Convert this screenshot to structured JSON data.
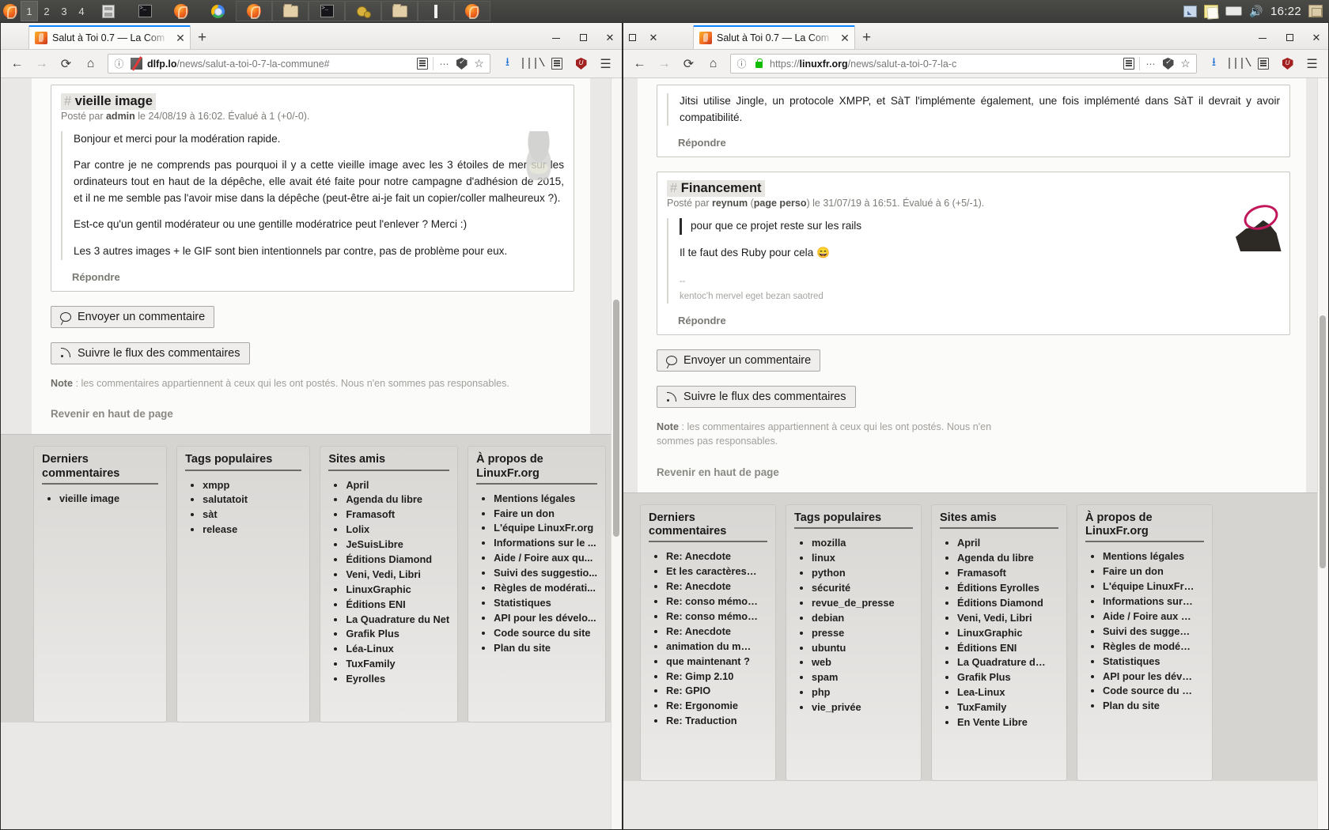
{
  "taskbar": {
    "workspaces": [
      "1",
      "2",
      "3",
      "4"
    ],
    "active_workspace": "1",
    "clock": "16:22",
    "launcher_icons": [
      "firefox-logo-icon",
      "files-icon",
      "terminal-icon",
      "firefox-icon",
      "chrome-icon",
      "firefox-window-icon",
      "folder-window-icon",
      "terminal-window-icon",
      "gimp-window-icon",
      "folder-window-icon-2",
      "text-editor-window-icon",
      "firefox-window-icon-2"
    ],
    "tray_icons": [
      "screenshot-tool-icon",
      "notes-icon",
      "drive-icon",
      "volume-icon",
      "trash-icon"
    ]
  },
  "windows": {
    "left": {
      "tab_title": "Salut à Toi 0.7 — La Com",
      "new_tab_label": "+",
      "close_label": "✕",
      "url_host": "dlfp.lo",
      "url_path": "/news/salut-a-toi-0-7-la-commune#",
      "security": "insecure-info-icon",
      "page": {
        "comment": {
          "hash": "#",
          "title": "vieille image",
          "meta_prefix": "Posté par ",
          "meta_author": "admin",
          "meta_suffix": " le 24/08/19 à 16:02. Évalué à 1 (+0/-0).",
          "paragraphs": [
            "Bonjour et merci pour la modération rapide.",
            "Par contre je ne comprends pas pourquoi il y a cette vieille image avec les 3 étoiles de mer sur les ordinateurs tout en haut de la dépêche, elle avait été faite pour notre campagne d'adhésion de 2015, et il ne me semble pas l'avoir mise dans la dépêche (peut-être ai-je fait un copier/coller malheureux ?).",
            "Est-ce qu'un gentil modérateur ou une gentille modératrice peut l'enlever ? Merci :)",
            "Les 3 autres images + le GIF sont bien intentionnels par contre, pas de problème pour eux."
          ],
          "reply_label": "Répondre"
        },
        "send_comment_button": "Envoyer un commentaire",
        "follow_feed_button": "Suivre le flux des commentaires",
        "note_label": "Note",
        "note_text": " : les commentaires appartiennent à ceux qui les ont postés. Nous n'en sommes pas responsables.",
        "back_to_top": "Revenir en haut de page"
      },
      "footer": {
        "columns": [
          {
            "title": "Derniers commentaires",
            "items": [
              "vieille image"
            ]
          },
          {
            "title": "Tags populaires",
            "items": [
              "xmpp",
              "salutatoit",
              "sàt",
              "release"
            ]
          },
          {
            "title": "Sites amis",
            "items": [
              "April",
              "Agenda du libre",
              "Framasoft",
              "Lolix",
              "JeSuisLibre",
              "Éditions Diamond",
              "Veni, Vedi, Libri",
              "LinuxGraphic",
              "Éditions ENI",
              "La Quadrature du Net",
              "Grafik Plus",
              "Léa-Linux",
              "TuxFamily",
              "Eyrolles"
            ]
          },
          {
            "title": "À propos de LinuxFr.org",
            "items": [
              "Mentions légales",
              "Faire un don",
              "L'équipe LinuxFr.org",
              "Informations sur le ...",
              "Aide / Foire aux qu...",
              "Suivi des suggestio...",
              "Règles de modérati...",
              "Statistiques",
              "API pour les dévelo...",
              "Code source du site",
              "Plan du site"
            ]
          }
        ]
      }
    },
    "right": {
      "tab_title": "Salut à Toi 0.7 — La Com",
      "new_tab_label": "+",
      "close_label": "✕",
      "url_scheme": "https://",
      "url_host": "linuxfr.org",
      "url_path": "/news/salut-a-toi-0-7-la-c",
      "security": "secure-lock-icon",
      "page": {
        "comment_top": {
          "text": "Jitsi utilise Jingle, un protocole XMPP, et SàT l'implémente également, une fois implémenté dans SàT il devrait y avoir compatibilité.",
          "reply_label": "Répondre"
        },
        "comment": {
          "hash": "#",
          "title": "Financement",
          "meta_prefix": "Posté par ",
          "meta_author": "reynum",
          "meta_link": "page perso",
          "meta_suffix": " le 31/07/19 à 16:51. Évalué à 6 (+5/-1).",
          "quote": "pour que ce projet reste sur les rails",
          "body": "Il te faut des Ruby pour cela 😄",
          "body_italic": "Ruby",
          "sig_sep": "--",
          "signature": "kentoc'h mervel eget bezan saotred",
          "reply_label": "Répondre"
        },
        "send_comment_button": "Envoyer un commentaire",
        "follow_feed_button": "Suivre le flux des commentaires",
        "note_label": "Note",
        "note_text": " : les commentaires appartiennent à ceux qui les ont postés. Nous n'en sommes pas responsables.",
        "back_to_top": "Revenir en haut de page"
      },
      "footer": {
        "columns": [
          {
            "title": "Derniers commentaires",
            "items": [
              "Re: Anecdote",
              "Et les caractères…",
              "Re: Anecdote",
              "Re: conso mémo…",
              "Re: conso mémo…",
              "Re: Anecdote",
              "animation du m…",
              "que maintenant ?",
              "Re: Gimp 2.10",
              "Re: GPIO",
              "Re: Ergonomie",
              "Re: Traduction"
            ]
          },
          {
            "title": "Tags populaires",
            "items": [
              "mozilla",
              "linux",
              "python",
              "sécurité",
              "revue_de_presse",
              "debian",
              "presse",
              "ubuntu",
              "web",
              "spam",
              "php",
              "vie_privée"
            ]
          },
          {
            "title": "Sites amis",
            "items": [
              "April",
              "Agenda du libre",
              "Framasoft",
              "Éditions Eyrolles",
              "Éditions Diamond",
              "Veni, Vedi, Libri",
              "LinuxGraphic",
              "Éditions ENI",
              "La Quadrature d…",
              "Grafik Plus",
              "Lea-Linux",
              "TuxFamily",
              "En Vente Libre"
            ]
          },
          {
            "title": "À propos de LinuxFr.org",
            "items": [
              "Mentions légales",
              "Faire un don",
              "L'équipe LinuxFr…",
              "Informations sur…",
              "Aide / Foire aux …",
              "Suivi des sugge…",
              "Règles de modé…",
              "Statistiques",
              "API pour les dév…",
              "Code source du …",
              "Plan du site"
            ]
          }
        ]
      }
    }
  }
}
